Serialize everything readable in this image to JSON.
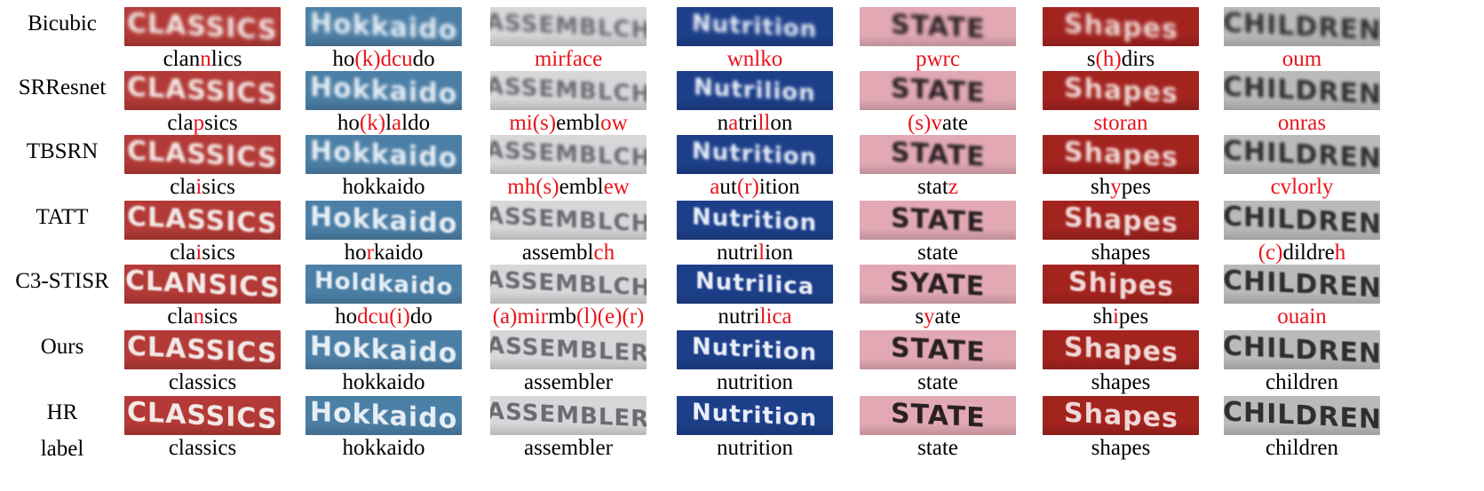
{
  "rows": [
    {
      "label_lines": [
        "Bicubic"
      ],
      "cells": [
        {
          "tile_text": "CLASSICS",
          "caption": [
            [
              "clan",
              0
            ],
            [
              "n",
              1
            ],
            [
              "lics",
              0
            ]
          ]
        },
        {
          "tile_text": "Hokkaido",
          "caption": [
            [
              "ho",
              0
            ],
            [
              "(k)dcu",
              1
            ],
            [
              "do",
              0
            ]
          ]
        },
        {
          "tile_text": "ASSEMBLCH",
          "caption": [
            [
              "mirface",
              1
            ]
          ]
        },
        {
          "tile_text": "Nutrition",
          "caption": [
            [
              "wnlko",
              1
            ]
          ]
        },
        {
          "tile_text": "STATE",
          "caption": [
            [
              "pwrc",
              1
            ]
          ]
        },
        {
          "tile_text": "Shapes",
          "caption": [
            [
              "s",
              0
            ],
            [
              "(h)",
              1
            ],
            [
              "dirs",
              0
            ]
          ]
        },
        {
          "tile_text": "CHILDREN",
          "caption": [
            [
              "oum",
              1
            ]
          ]
        }
      ]
    },
    {
      "label_lines": [
        "SRResnet"
      ],
      "cells": [
        {
          "tile_text": "CLASSICS",
          "caption": [
            [
              "cla",
              0
            ],
            [
              "p",
              1
            ],
            [
              "sics",
              0
            ]
          ]
        },
        {
          "tile_text": "Hokkaido",
          "caption": [
            [
              "ho",
              0
            ],
            [
              "(k)",
              1
            ],
            [
              "l",
              0
            ],
            [
              "a",
              1
            ],
            [
              "ldo",
              0
            ]
          ]
        },
        {
          "tile_text": "ASSEMBLCH",
          "caption": [
            [
              "mi(s)",
              1
            ],
            [
              "embl",
              0
            ],
            [
              "ow",
              1
            ]
          ]
        },
        {
          "tile_text": "Nutrilion",
          "caption": [
            [
              "n",
              0
            ],
            [
              "a",
              1
            ],
            [
              "tri",
              0
            ],
            [
              "ll",
              1
            ],
            [
              "on",
              0
            ]
          ]
        },
        {
          "tile_text": "STATE",
          "caption": [
            [
              "(s)v",
              1
            ],
            [
              "ate",
              0
            ]
          ]
        },
        {
          "tile_text": "Shapes",
          "caption": [
            [
              "storan",
              1
            ]
          ]
        },
        {
          "tile_text": "CHILDREN",
          "caption": [
            [
              "onras",
              1
            ]
          ]
        }
      ]
    },
    {
      "label_lines": [
        "TBSRN"
      ],
      "cells": [
        {
          "tile_text": "CLASSICS",
          "caption": [
            [
              "cla",
              0
            ],
            [
              "i",
              1
            ],
            [
              "sics",
              0
            ]
          ]
        },
        {
          "tile_text": "Hokkaido",
          "caption": [
            [
              "hokkaido",
              0
            ]
          ]
        },
        {
          "tile_text": "ASSEMBLCH",
          "caption": [
            [
              "mh(s)",
              1
            ],
            [
              "embl",
              0
            ],
            [
              "ew",
              1
            ]
          ]
        },
        {
          "tile_text": "Nutrition",
          "caption": [
            [
              "a",
              1
            ],
            [
              "ut",
              0
            ],
            [
              "(r)",
              1
            ],
            [
              "ition",
              0
            ]
          ]
        },
        {
          "tile_text": "STATE",
          "caption": [
            [
              "stat",
              0
            ],
            [
              "z",
              1
            ]
          ]
        },
        {
          "tile_text": "Shapes",
          "caption": [
            [
              "sh",
              0
            ],
            [
              "y",
              1
            ],
            [
              "pes",
              0
            ]
          ]
        },
        {
          "tile_text": "CHILDREN",
          "caption": [
            [
              "cvlorly",
              1
            ]
          ]
        }
      ]
    },
    {
      "label_lines": [
        "TATT"
      ],
      "cells": [
        {
          "tile_text": "CLASSICS",
          "caption": [
            [
              "cla",
              0
            ],
            [
              "i",
              1
            ],
            [
              "sics",
              0
            ]
          ]
        },
        {
          "tile_text": "Hokkaido",
          "caption": [
            [
              "ho",
              0
            ],
            [
              "r",
              1
            ],
            [
              "kaido",
              0
            ]
          ]
        },
        {
          "tile_text": "ASSEMBLCH",
          "caption": [
            [
              "assembl",
              0
            ],
            [
              "ch",
              1
            ]
          ]
        },
        {
          "tile_text": "Nutrition",
          "caption": [
            [
              "nutri",
              0
            ],
            [
              "l",
              1
            ],
            [
              "ion",
              0
            ]
          ]
        },
        {
          "tile_text": "STATE",
          "caption": [
            [
              "state",
              0
            ]
          ]
        },
        {
          "tile_text": "Shapes",
          "caption": [
            [
              "shapes",
              0
            ]
          ]
        },
        {
          "tile_text": "CHILDREN",
          "caption": [
            [
              "(c)",
              1
            ],
            [
              "dildre",
              0
            ],
            [
              "h",
              1
            ]
          ]
        }
      ]
    },
    {
      "label_lines": [
        "C3-STISR"
      ],
      "cells": [
        {
          "tile_text": "CLANSICS",
          "caption": [
            [
              "cla",
              0
            ],
            [
              "n",
              1
            ],
            [
              "sics",
              0
            ]
          ]
        },
        {
          "tile_text": "Holdkaido",
          "caption": [
            [
              "ho",
              0
            ],
            [
              "dcu(i)",
              1
            ],
            [
              "do",
              0
            ]
          ]
        },
        {
          "tile_text": "ASSEMBLCH",
          "caption": [
            [
              "(a)mir",
              1
            ],
            [
              "mb",
              0
            ],
            [
              "(l)(e)(r)",
              1
            ]
          ]
        },
        {
          "tile_text": "Nutrilica",
          "caption": [
            [
              "nutri",
              0
            ],
            [
              "lica",
              1
            ]
          ]
        },
        {
          "tile_text": "SYATE",
          "caption": [
            [
              "s",
              0
            ],
            [
              "y",
              1
            ],
            [
              "ate",
              0
            ]
          ]
        },
        {
          "tile_text": "Shipes",
          "caption": [
            [
              "sh",
              0
            ],
            [
              "i",
              1
            ],
            [
              "pes",
              0
            ]
          ]
        },
        {
          "tile_text": "CHILDREN",
          "caption": [
            [
              "ouain",
              1
            ]
          ]
        }
      ]
    },
    {
      "label_lines": [
        "Ours"
      ],
      "cells": [
        {
          "tile_text": "CLASSICS",
          "caption": [
            [
              "classics",
              0
            ]
          ]
        },
        {
          "tile_text": "Hokkaido",
          "caption": [
            [
              "hokkaido",
              0
            ]
          ]
        },
        {
          "tile_text": "ASSEMBLER",
          "caption": [
            [
              "assembler",
              0
            ]
          ]
        },
        {
          "tile_text": "Nutrition",
          "caption": [
            [
              "nutrition",
              0
            ]
          ]
        },
        {
          "tile_text": "STATE",
          "caption": [
            [
              "state",
              0
            ]
          ]
        },
        {
          "tile_text": "Shapes",
          "caption": [
            [
              "shapes",
              0
            ]
          ]
        },
        {
          "tile_text": "CHILDREN",
          "caption": [
            [
              "children",
              0
            ]
          ]
        }
      ]
    },
    {
      "label_lines": [
        "HR",
        "label"
      ],
      "cells": [
        {
          "tile_text": "CLASSICS",
          "caption": [
            [
              "classics",
              0
            ]
          ]
        },
        {
          "tile_text": "Hokkaido",
          "caption": [
            [
              "hokkaido",
              0
            ]
          ]
        },
        {
          "tile_text": "ASSEMBLER",
          "caption": [
            [
              "assembler",
              0
            ]
          ]
        },
        {
          "tile_text": "Nutrition",
          "caption": [
            [
              "nutrition",
              0
            ]
          ]
        },
        {
          "tile_text": "STATE",
          "caption": [
            [
              "state",
              0
            ]
          ]
        },
        {
          "tile_text": "Shapes",
          "caption": [
            [
              "shapes",
              0
            ]
          ]
        },
        {
          "tile_text": "CHILDREN",
          "caption": [
            [
              "children",
              0
            ]
          ]
        }
      ]
    }
  ],
  "column_styles": [
    {
      "bg": "#b33a36",
      "fg": "#f3e9e6"
    },
    {
      "bg": "#4c7fa6",
      "fg": "#e6eef5"
    },
    {
      "bg": "#d7d7d9",
      "fg": "#6b6b72"
    },
    {
      "bg": "#1d3f8a",
      "fg": "#e9eef9"
    },
    {
      "bg": "#e2a9b4",
      "fg": "#2a2024"
    },
    {
      "bg": "#a3231f",
      "fg": "#f0d8d6"
    },
    {
      "bg": "#b9bbba",
      "fg": "#2e302f"
    }
  ],
  "colors": {
    "wrong": "#e8141b",
    "correct": "#000000"
  }
}
